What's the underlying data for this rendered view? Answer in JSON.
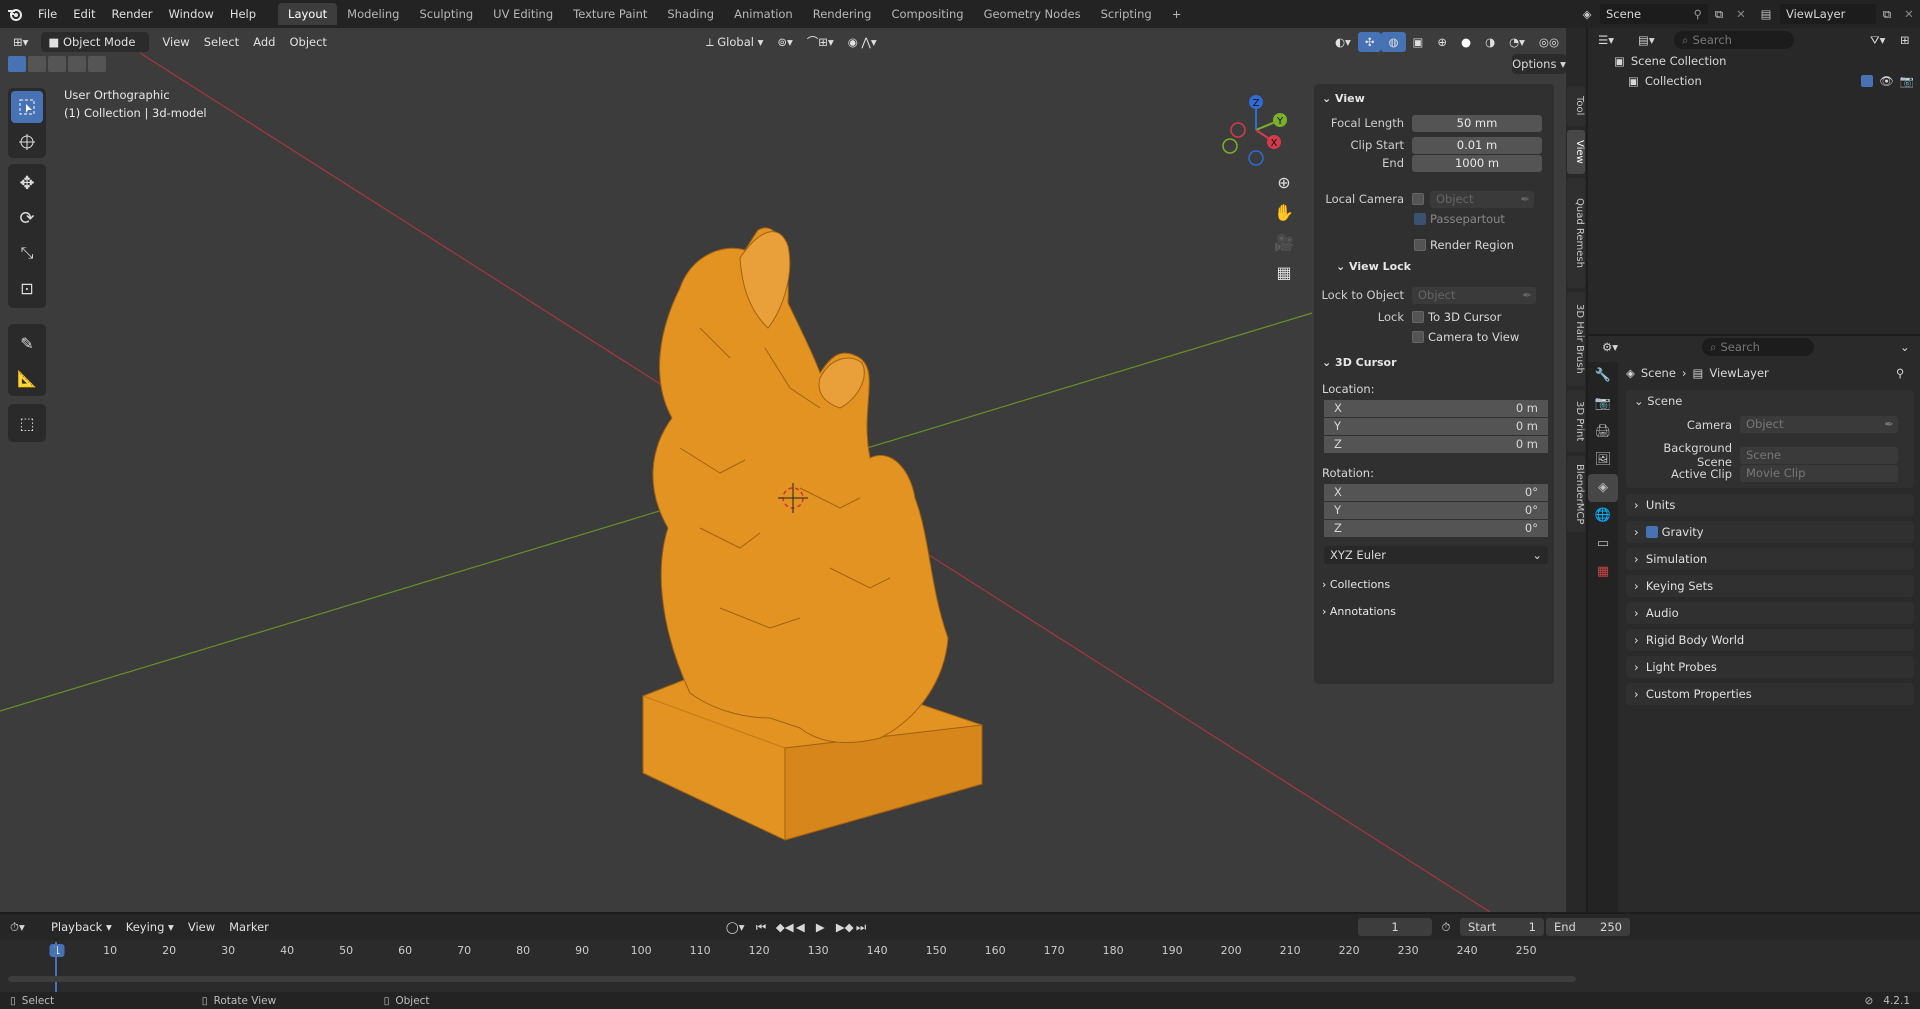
{
  "topbar": {
    "menus": [
      "File",
      "Edit",
      "Render",
      "Window",
      "Help"
    ],
    "workspaces": [
      "Layout",
      "Modeling",
      "Sculpting",
      "UV Editing",
      "Texture Paint",
      "Shading",
      "Animation",
      "Rendering",
      "Compositing",
      "Geometry Nodes",
      "Scripting"
    ],
    "active_workspace": "Layout",
    "scene": "Scene",
    "view_layer": "ViewLayer"
  },
  "viewport": {
    "mode": "Object Mode",
    "menus": [
      "View",
      "Select",
      "Add",
      "Object"
    ],
    "transform": "Global",
    "options": "Options",
    "overlay_line1": "User Orthographic",
    "overlay_line2": "(1) Collection | 3d-model",
    "gizmo": {
      "x": "X",
      "y": "Y",
      "z": "Z"
    },
    "colors": {
      "object": "#e39321",
      "x_axis": "#a8363f",
      "y_axis": "#6a8f27",
      "background": "#3c3c3c"
    }
  },
  "npanel": {
    "view_title": "View",
    "focal_length_label": "Focal Length",
    "focal_length": "50 mm",
    "clip_start_label": "Clip Start",
    "clip_start": "0.01 m",
    "clip_end_label": "End",
    "clip_end": "1000 m",
    "local_camera_label": "Local Camera",
    "object_placeholder": "Object",
    "passepartout": "Passepartout",
    "render_region": "Render Region",
    "view_lock_title": "View Lock",
    "lock_to_object_label": "Lock to Object",
    "lock_label": "Lock",
    "to_3d_cursor": "To 3D Cursor",
    "camera_to_view": "Camera to View",
    "cursor_title": "3D Cursor",
    "location_label": "Location:",
    "loc": [
      {
        "axis": "X",
        "value": "0 m"
      },
      {
        "axis": "Y",
        "value": "0 m"
      },
      {
        "axis": "Z",
        "value": "0 m"
      }
    ],
    "rotation_label": "Rotation:",
    "rot": [
      {
        "axis": "X",
        "value": "0°"
      },
      {
        "axis": "Y",
        "value": "0°"
      },
      {
        "axis": "Z",
        "value": "0°"
      }
    ],
    "rotation_mode": "XYZ Euler",
    "collections": "Collections",
    "annotations": "Annotations"
  },
  "sidetabs": [
    "Tool",
    "View",
    "Quad Remesh",
    "3D Hair Brush",
    "3D Print",
    "BlenderMCP"
  ],
  "outliner": {
    "search_placeholder": "Search",
    "scene_collection": "Scene Collection",
    "collection": "Collection"
  },
  "properties": {
    "search_placeholder": "Search",
    "breadcrumb_scene": "Scene",
    "breadcrumb_viewlayer": "ViewLayer",
    "scene_panel": "Scene",
    "camera_label": "Camera",
    "camera_placeholder": "Object",
    "background_scene_label": "Background Scene",
    "background_scene_placeholder": "Scene",
    "active_clip_label": "Active Clip",
    "active_clip_placeholder": "Movie Clip",
    "panels": [
      "Units",
      "Gravity",
      "Simulation",
      "Keying Sets",
      "Audio",
      "Rigid Body World",
      "Light Probes",
      "Custom Properties"
    ]
  },
  "timeline": {
    "menus": [
      "Playback",
      "Keying",
      "View",
      "Marker"
    ],
    "current_frame": "1",
    "start_label": "Start",
    "start": "1",
    "end_label": "End",
    "end": "250",
    "ticks": [
      "1",
      "10",
      "20",
      "30",
      "40",
      "50",
      "60",
      "70",
      "80",
      "90",
      "100",
      "110",
      "120",
      "130",
      "140",
      "150",
      "160",
      "170",
      "180",
      "190",
      "200",
      "210",
      "220",
      "230",
      "240",
      "250"
    ]
  },
  "statusbar": {
    "select": "Select",
    "rotate_view": "Rotate View",
    "object": "Object",
    "version": "4.2.1"
  }
}
